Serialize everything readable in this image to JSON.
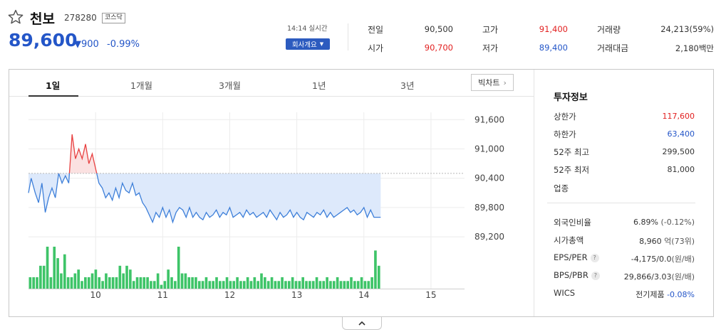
{
  "stock": {
    "name": "천보",
    "code": "278280",
    "market": "코스닥",
    "price": "89,600",
    "change": "900",
    "change_rate": "-0.99%",
    "realtime": "14:14 실시간",
    "company_button": "회사개요"
  },
  "summary": [
    {
      "label": "전일",
      "value": "90,500",
      "color": "dark"
    },
    {
      "label": "고가",
      "value": "91,400",
      "color": "red"
    },
    {
      "label": "거래량",
      "value": "24,213(59%)",
      "color": "dark"
    },
    {
      "label": "시가",
      "value": "90,700",
      "color": "red"
    },
    {
      "label": "저가",
      "value": "89,400",
      "color": "blue"
    },
    {
      "label": "거래대금",
      "value": "2,180백만",
      "color": "dark"
    }
  ],
  "tabs": [
    "1일",
    "1개월",
    "3개월",
    "1년",
    "3년"
  ],
  "active_tab": "1일",
  "big_chart_label": "빅차트",
  "invest_info": {
    "title": "투자정보",
    "group1": [
      {
        "label": "상한가",
        "value": "117,600",
        "color": "red"
      },
      {
        "label": "하한가",
        "value": "63,400",
        "color": "blue"
      },
      {
        "label": "52주 최고",
        "value": "299,500",
        "color": "dark"
      },
      {
        "label": "52주 최저",
        "value": "81,000",
        "color": "dark"
      },
      {
        "label": "업종",
        "value": "",
        "color": "dark"
      }
    ],
    "group2": [
      {
        "label": "외국인비율",
        "value": "6.89%",
        "extra": "(-0.12%)",
        "help": false
      },
      {
        "label": "시가총액",
        "value": "8,960",
        "extra": "억(73위)",
        "help": false
      },
      {
        "label": "EPS/PER",
        "value": "-4,175/0.0",
        "extra": "(원/배)",
        "help": true
      },
      {
        "label": "BPS/PBR",
        "value": "29,866/3.03",
        "extra": "(원/배)",
        "help": true
      },
      {
        "label": "WICS",
        "value": "전기제품",
        "extra": "-0.08%",
        "help": false
      }
    ]
  },
  "chart_data": {
    "type": "line",
    "title": "",
    "x_ticks": [
      "10",
      "11",
      "12",
      "13",
      "14",
      "15"
    ],
    "y_ticks": [
      "91,600",
      "91,000",
      "90,400",
      "89,800",
      "89,200"
    ],
    "ylim": [
      89100,
      91750
    ],
    "xlim": [
      9.0,
      15.5
    ],
    "reference": 90500,
    "colors": {
      "up": "#e84040",
      "down": "#3d7fd9",
      "volume": "#3ec468"
    },
    "series": [
      {
        "name": "price",
        "x": [
          9.0,
          9.04,
          9.1,
          9.15,
          9.2,
          9.25,
          9.3,
          9.35,
          9.4,
          9.45,
          9.5,
          9.55,
          9.6,
          9.65,
          9.7,
          9.75,
          9.8,
          9.85,
          9.9,
          9.95,
          10.0,
          10.05,
          10.1,
          10.15,
          10.2,
          10.25,
          10.3,
          10.35,
          10.4,
          10.45,
          10.5,
          10.55,
          10.6,
          10.65,
          10.7,
          10.75,
          10.8,
          10.85,
          10.9,
          10.95,
          11.0,
          11.05,
          11.1,
          11.15,
          11.2,
          11.25,
          11.3,
          11.35,
          11.4,
          11.45,
          11.5,
          11.55,
          11.6,
          11.65,
          11.7,
          11.75,
          11.8,
          11.85,
          11.9,
          11.95,
          12.0,
          12.05,
          12.1,
          12.15,
          12.2,
          12.25,
          12.3,
          12.35,
          12.4,
          12.45,
          12.5,
          12.55,
          12.6,
          12.65,
          12.7,
          12.75,
          12.8,
          12.85,
          12.9,
          12.95,
          13.0,
          13.05,
          13.1,
          13.15,
          13.2,
          13.25,
          13.3,
          13.35,
          13.4,
          13.45,
          13.5,
          13.55,
          13.6,
          13.65,
          13.7,
          13.75,
          13.8,
          13.85,
          13.9,
          13.95,
          14.0,
          14.05,
          14.1,
          14.15,
          14.2,
          14.25
        ],
        "values": [
          90100,
          90400,
          90100,
          89900,
          90300,
          89700,
          90000,
          90200,
          90000,
          90500,
          90300,
          90450,
          90300,
          91300,
          90800,
          91000,
          90800,
          91100,
          90700,
          90900,
          90600,
          90300,
          90200,
          90000,
          90100,
          89950,
          90200,
          90000,
          90300,
          90150,
          90100,
          90300,
          90050,
          90100,
          89900,
          89800,
          89650,
          89500,
          89700,
          89600,
          89800,
          89600,
          89750,
          89500,
          89700,
          89800,
          89750,
          89600,
          89800,
          89600,
          89700,
          89600,
          89550,
          89700,
          89600,
          89650,
          89750,
          89600,
          89700,
          89650,
          89800,
          89600,
          89650,
          89700,
          89600,
          89750,
          89650,
          89700,
          89600,
          89650,
          89700,
          89600,
          89750,
          89650,
          89550,
          89700,
          89600,
          89650,
          89750,
          89600,
          89700,
          89600,
          89550,
          89700,
          89650,
          89600,
          89700,
          89650,
          89750,
          89600,
          89700,
          89600,
          89650,
          89700,
          89750,
          89800,
          89700,
          89750,
          89650,
          89700,
          89800,
          89600,
          89750,
          89600,
          89600,
          89600
        ]
      },
      {
        "name": "volume",
        "values": [
          3,
          3,
          3,
          6,
          6,
          11,
          3,
          11,
          8,
          4,
          9,
          3,
          3,
          4,
          5,
          2,
          3,
          3,
          4,
          5,
          3,
          2,
          4,
          3,
          3,
          3,
          6,
          4,
          6,
          5,
          2,
          3,
          3,
          3,
          3,
          2,
          2,
          4,
          1,
          2,
          5,
          3,
          2,
          11,
          4,
          4,
          3,
          3,
          3,
          2,
          2,
          3,
          2,
          2,
          3,
          2,
          2,
          3,
          2,
          2,
          3,
          2,
          2,
          3,
          2,
          3,
          2,
          4,
          3,
          2,
          3,
          2,
          2,
          3,
          2,
          2,
          3,
          2,
          2,
          3,
          2,
          2,
          2,
          3,
          2,
          2,
          3,
          2,
          2,
          3,
          2,
          2,
          2,
          3,
          2,
          2,
          3,
          2,
          2,
          3,
          10,
          6
        ]
      }
    ]
  }
}
